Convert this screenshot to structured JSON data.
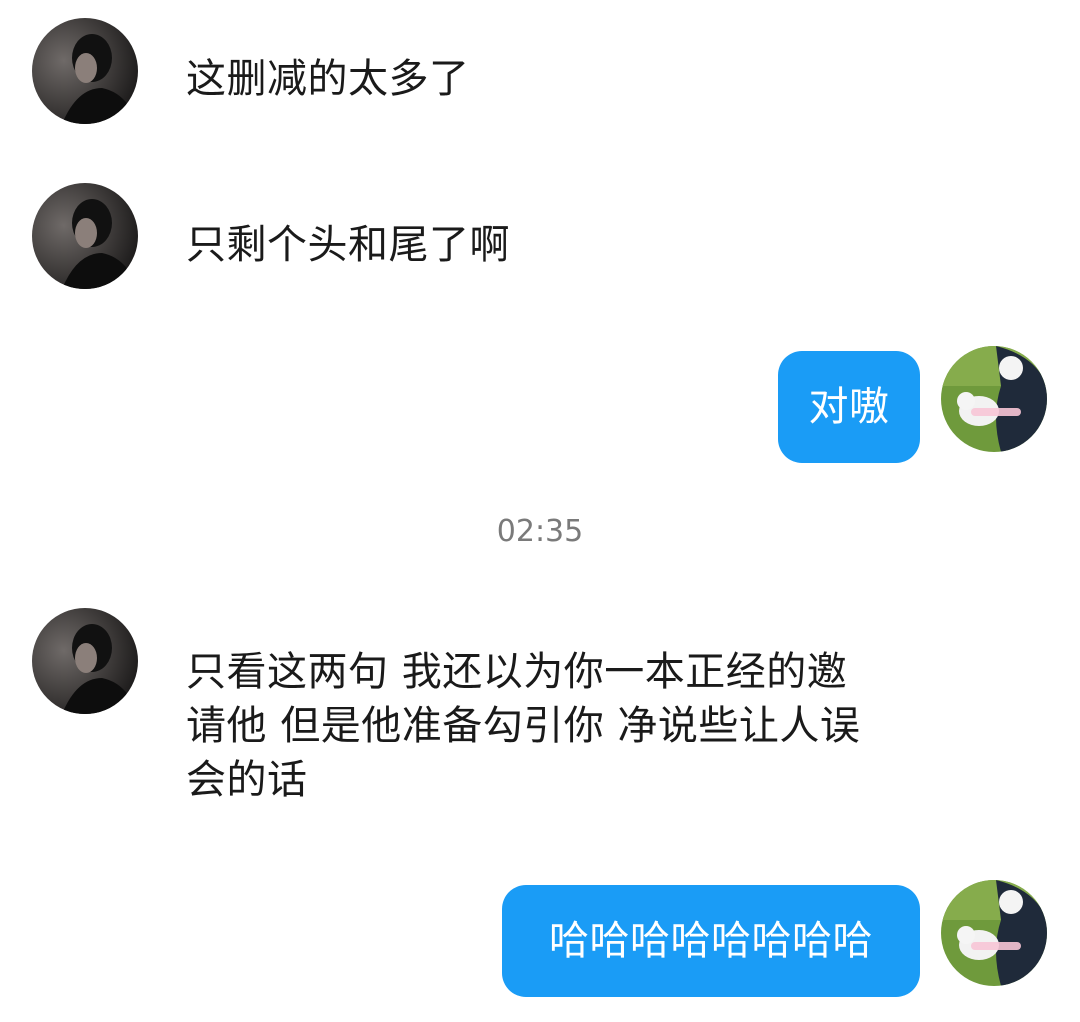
{
  "chat": {
    "messages": [
      {
        "side": "left",
        "text": "这删减的太多了"
      },
      {
        "side": "left",
        "text": "只剩个头和尾了啊"
      },
      {
        "side": "right",
        "text": "对嗷"
      },
      {
        "side": "left",
        "text": "只看这两句 我还以为你一本正经的邀请他 但是他准备勾引你 净说些让人误会的话"
      },
      {
        "side": "right",
        "text": "哈哈哈哈哈哈哈哈"
      }
    ],
    "timestamp": "02:35"
  },
  "colors": {
    "bubble_right": "#1a9cf6",
    "text": "#1a1a1a",
    "timestamp": "#7a7a7a",
    "background": "#ffffff"
  },
  "icons": {
    "left_avatar": "dark-portrait-avatar",
    "right_avatar": "dog-on-grass-avatar"
  }
}
